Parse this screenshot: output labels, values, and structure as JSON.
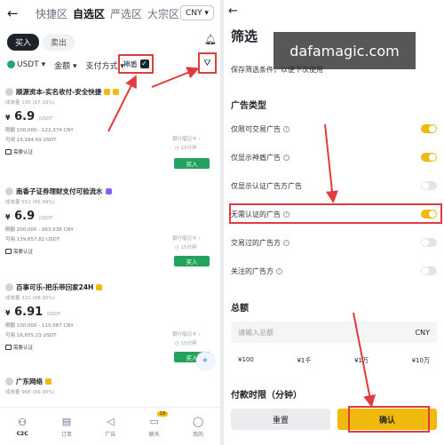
{
  "left": {
    "back_icon": "←",
    "tabs": [
      "快捷区",
      "自选区",
      "严选区",
      "大宗区"
    ],
    "currency": "CNY ▾",
    "seg": {
      "buy": "买入",
      "sell": "卖出"
    },
    "filters": {
      "coin": "USDT ▾",
      "amount": "金额 ▾",
      "payment": "支付方式 ▾",
      "shield": "神盾",
      "check": "✓"
    },
    "ads": [
      {
        "name": "顺源资本-实名收付-安全快捷",
        "stats": "成单量 195 (97.10%)",
        "price": "6.9",
        "decimals": "",
        "unit": "/USDT",
        "limit": "限额 100,000 - 122,374 CNY",
        "qty": "可用 19,184.69 USDT",
        "pm1": "银行借记卡 ›",
        "pm2": "◷ 15分钟",
        "tag": "需要认证",
        "buy": "买入"
      },
      {
        "name": "南香子证券理财支付可验流水",
        "stats": "成单量 552 (99.99%)",
        "price": "6.9",
        "decimals": "",
        "unit": "/USDT",
        "limit": "限额 200,000 - 963,638 CNY",
        "qty": "可用 139,657.82 USDT",
        "pm1": "银行借记卡 ›",
        "pm2": "◷ 15分钟",
        "tag": "需要认证",
        "buy": "买入"
      },
      {
        "name": "百事可乐-把乐带回家24H",
        "stats": "成单量 221 (98.30%)",
        "price": "6.9",
        "decimals": "1",
        "unit": "/USDT",
        "limit": "限额 100,000 - 115,087 CNY",
        "qty": "可用 16,655.23 USDT",
        "pm1": "银行借记卡 ›",
        "pm2": "◷ 15分钟",
        "tag": "需要认证",
        "buy": "买入"
      },
      {
        "name": "广东网络",
        "stats": "成单量 968 (99.90%)",
        "price": "",
        "decimals": "",
        "unit": "",
        "limit": "",
        "qty": "",
        "pm1": "",
        "pm2": "",
        "tag": "",
        "buy": ""
      }
    ],
    "nav": [
      {
        "icon": "⚇",
        "label": "C2C",
        "active": true,
        "count": ""
      },
      {
        "icon": "▤",
        "label": "订单",
        "active": false,
        "count": ""
      },
      {
        "icon": "◁",
        "label": "广告",
        "active": false,
        "count": ""
      },
      {
        "icon": "▭",
        "label": "聊天",
        "active": false,
        "count": "19"
      },
      {
        "icon": "◯",
        "label": "我的",
        "active": false,
        "count": ""
      }
    ],
    "fab_icon": "✦"
  },
  "right": {
    "back_icon": "←",
    "title": "筛选",
    "watermark": "dafamagic.com",
    "save_text": "保存筛选条件，以便下次使用",
    "ad_type_title": "广告类型",
    "ad_type_rows": [
      {
        "label": "仅限可交易广告",
        "info": "i",
        "on": true
      },
      {
        "label": "仅显示神盾广告",
        "info": "i",
        "on": true
      },
      {
        "label": "仅显示认证广告方广告",
        "info": "",
        "on": false
      },
      {
        "label": "无需认证的广告",
        "info": "i",
        "on": true
      },
      {
        "label": "交易过的广告方",
        "info": "i",
        "on": false
      },
      {
        "label": "关注的广告方",
        "info": "i",
        "on": false
      }
    ],
    "amount_title": "总额",
    "amount_placeholder": "请输入总额",
    "amount_currency": "CNY",
    "presets": [
      "¥100",
      "¥1千",
      "¥1万",
      "¥10万"
    ],
    "pay_time_title": "付款时限（分钟）",
    "reset": "重置",
    "confirm": "确认"
  },
  "colors": {
    "accent": "#f0b90b",
    "buy": "#23a35e",
    "annotation": "#e23b3b"
  }
}
